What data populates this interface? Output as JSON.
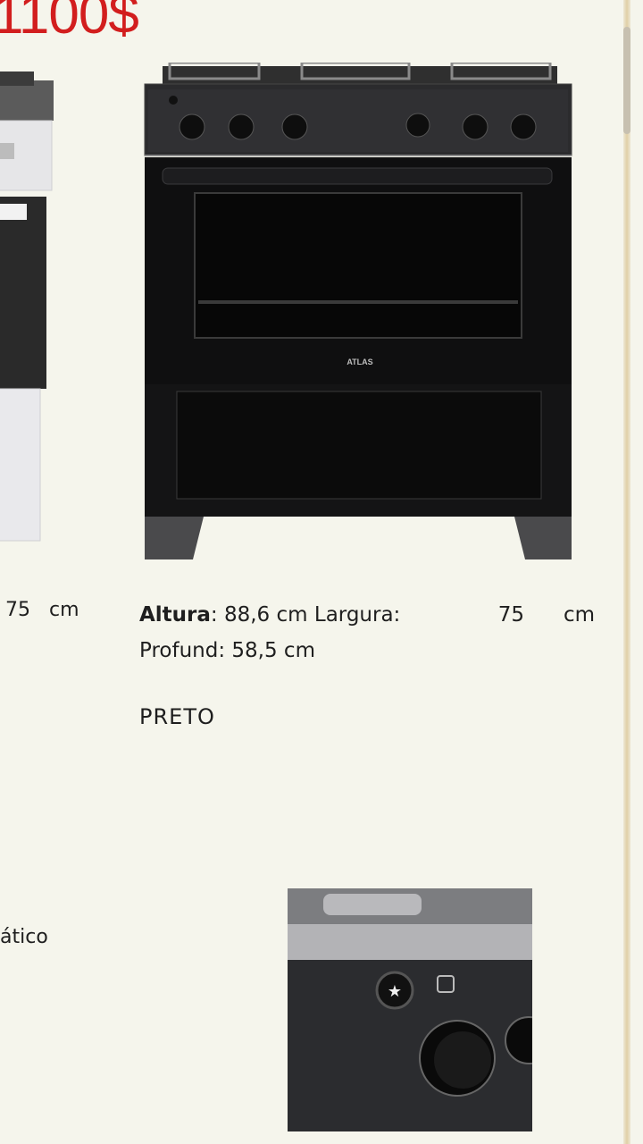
{
  "price": {
    "text": "1100$"
  },
  "product": {
    "brand": "ATLAS",
    "specs": {
      "height_label": "Altura",
      "height_value": ": 88,6 cm",
      "width_label": "Largura:",
      "width_value": "75",
      "width_unit": "cm",
      "depth_line": "Profund: 58,5 cm"
    },
    "color": "PRETO"
  },
  "left_column": {
    "dims_value": "75",
    "dims_unit": "cm",
    "snippet": "ático"
  }
}
